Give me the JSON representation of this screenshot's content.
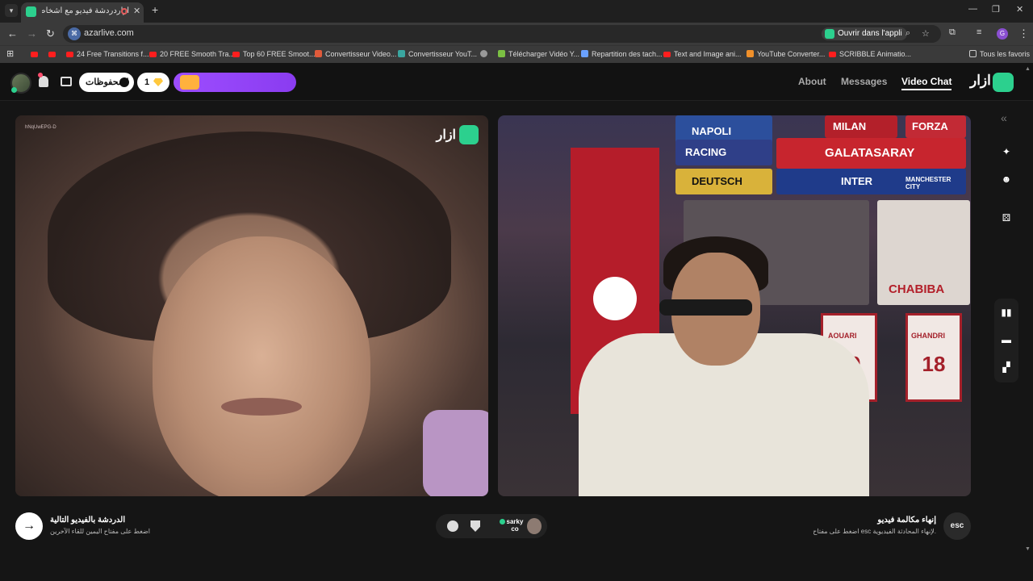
{
  "browser": {
    "tab_title": "آزاردردشة فيديو مع أشخاص",
    "url": "azarlive.com",
    "open_in_app": "Ouvrir dans l'appli",
    "profile_initial": "G",
    "bookmarks": [
      "24 Free Transitions f...",
      "20 FREE Smooth Tra...",
      "Top 60 FREE Smoot...",
      "Convertisseur Video...",
      "Convertisseur YouT...",
      "Télécharger Vidéo Y...",
      "Repartition des tach...",
      "Text and Image ani...",
      "YouTube Converter...",
      "SCRIBBLE Animatio...",
      "Tous les favoris"
    ]
  },
  "header": {
    "saved_label": "المحفوظات",
    "gems_count": "1",
    "nav": {
      "about": "About",
      "messages": "Messages",
      "video_chat": "Video Chat"
    },
    "logo_text": "ازار"
  },
  "video_left": {
    "id_label": "hNqUwEPG-D",
    "logo_text": "ازار"
  },
  "video_right": {
    "poster_texts": [
      "NAPOLI",
      "MILAN",
      "FORZA",
      "RACING",
      "GALATASARAY",
      "INTER",
      "DEUTSCH",
      "CHABIBA",
      "MANCHESTER CITY"
    ],
    "jersey_left_name": "AOUARI",
    "jersey_left_number": "19",
    "jersey_right_name": "GHANDRI",
    "jersey_right_number": "18"
  },
  "bottom": {
    "next_title": "الدردشة بالفيديو التالية",
    "next_sub": "اضغط على مفتاح اليمين للقاء الآخرين",
    "user_name_line1": "sarky",
    "user_name_line2": "co",
    "end_title": "إنهاء مكالمة فيديو",
    "end_sub": "اضغط على مفتاح esc لإنهاء المحادثة الفيديوية.",
    "esc_label": "esc"
  },
  "colors": {
    "brand": "#2cd08e",
    "promo": "#9d4dff",
    "gem": "#ffc83d"
  }
}
